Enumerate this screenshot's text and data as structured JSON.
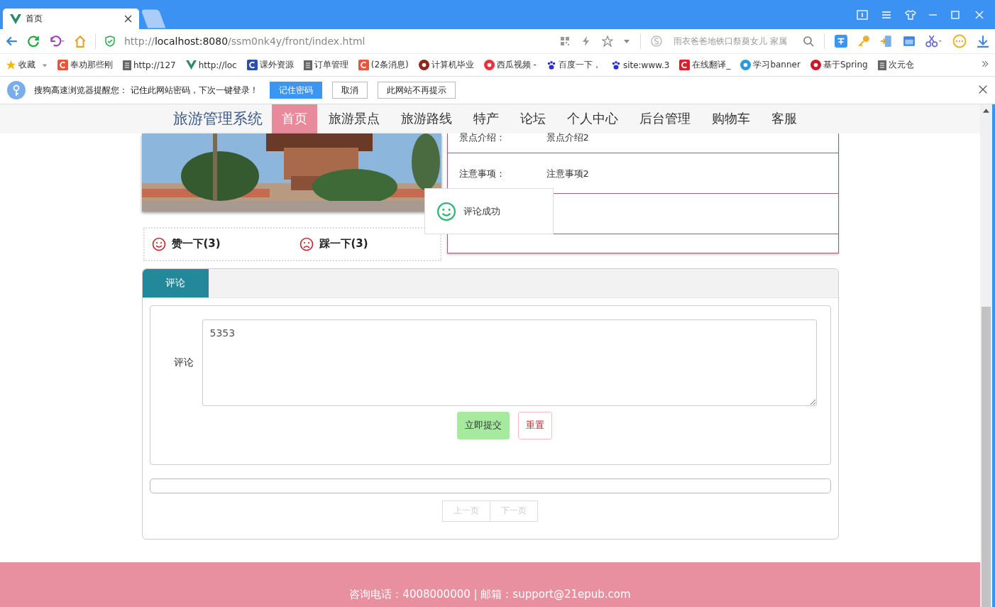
{
  "browser": {
    "tabs": [
      {
        "title": "首页",
        "selected": true
      },
      {
        "selected": false
      }
    ],
    "url": {
      "prefix": "http://",
      "host": "localhost:8080",
      "path": "/ssm0nk4y/front/index.html"
    },
    "search": {
      "placeholder": "雨衣爸爸地铁口祭奠女儿 家属"
    },
    "bookmarks": [
      {
        "label": "收藏",
        "kind": "star",
        "color": "#f4b400"
      },
      {
        "label": "奉劝那些刚",
        "kind": "site",
        "color": "#e8553a"
      },
      {
        "label": "http://127",
        "kind": "doc",
        "color": "#666666"
      },
      {
        "label": "http://loc",
        "kind": "vue",
        "color": "#2a8a6a"
      },
      {
        "label": "课外资源",
        "kind": "site",
        "color": "#2a4fa8"
      },
      {
        "label": "订单管理",
        "kind": "doc",
        "color": "#666666"
      },
      {
        "label": "(2条消息)",
        "kind": "site",
        "color": "#e8553a"
      },
      {
        "label": "计算机毕业",
        "kind": "round",
        "color": "#8a2a1a"
      },
      {
        "label": "西瓜视频 -",
        "kind": "round",
        "color": "#e8333a"
      },
      {
        "label": "百度一下，",
        "kind": "paw",
        "color": "#2a32c8"
      },
      {
        "label": "site:www.3",
        "kind": "paw",
        "color": "#2a32c8"
      },
      {
        "label": "在线翻译_",
        "kind": "site",
        "color": "#d8202a"
      },
      {
        "label": "学习banner",
        "kind": "round",
        "color": "#2a9ad8"
      },
      {
        "label": "基于Spring",
        "kind": "round",
        "color": "#c81a2a"
      },
      {
        "label": "次元仓",
        "kind": "doc",
        "color": "#666666"
      }
    ],
    "notice": {
      "text": "搜狗高速浏览器提醒您： 记住此网站密码，下次一键登录！",
      "buttons": [
        {
          "label": "记住密码",
          "primary": true
        },
        {
          "label": "取消",
          "primary": false
        },
        {
          "label": "此网站不再提示",
          "primary": false
        }
      ]
    }
  },
  "site": {
    "brand": "旅游管理系统",
    "nav": [
      {
        "label": "首页",
        "selected": true
      },
      {
        "label": "旅游景点",
        "selected": false
      },
      {
        "label": "旅游路线",
        "selected": false
      },
      {
        "label": "特产",
        "selected": false
      },
      {
        "label": "论坛",
        "selected": false
      },
      {
        "label": "个人中心",
        "selected": false
      },
      {
        "label": "后台管理",
        "selected": false
      },
      {
        "label": "购物车",
        "selected": false
      },
      {
        "label": "客服",
        "selected": false
      }
    ],
    "details": [
      {
        "kind": "field",
        "label": "景点介绍：",
        "value": "景点介绍2"
      },
      {
        "kind": "field",
        "label": "注意事项：",
        "value": "注意事项2"
      },
      {
        "kind": "blank"
      }
    ],
    "votes": [
      {
        "label": "赞一下(3)",
        "kind": "like"
      },
      {
        "label": "踩一下(3)",
        "kind": "dislike"
      }
    ],
    "comment_tabs": [
      {
        "label": "评论",
        "selected": true
      }
    ],
    "form": {
      "label": "评论",
      "value": "5353",
      "buttons": [
        {
          "label": "立即提交",
          "kind": "submit"
        },
        {
          "label": "重置",
          "kind": "reset"
        }
      ]
    },
    "pagination": [
      {
        "label": "上一页",
        "disabled": true
      },
      {
        "label": "下一页",
        "disabled": true
      }
    ],
    "toast": {
      "text": "评论成功"
    },
    "footer": "咨询电话：4008000000 | 邮箱：support@21epub.com"
  }
}
